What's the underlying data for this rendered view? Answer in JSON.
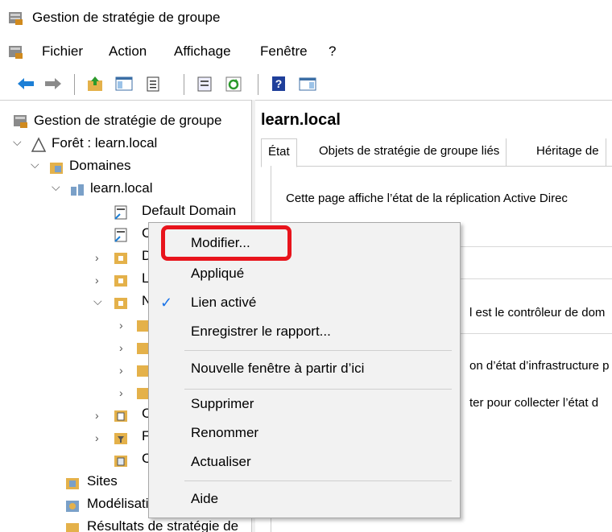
{
  "window": {
    "title": "Gestion de stratégie de groupe"
  },
  "menubar": {
    "items": [
      "Fichier",
      "Action",
      "Affichage",
      "Fenêtre",
      "?"
    ]
  },
  "toolbar": {
    "buttons": [
      "back-arrow-icon",
      "forward-arrow-icon",
      "up-folder-icon",
      "show-hide-tree-icon",
      "properties-icon",
      "export-list-icon",
      "refresh-icon",
      "help-icon",
      "console-tree-icon"
    ]
  },
  "tree": {
    "root": "Gestion de stratégie de groupe",
    "forest": "Forêt : learn.local",
    "domains": "Domaines",
    "domain": "learn.local",
    "gpo_default": "Default Domain",
    "gpo_selected": "C",
    "items_partial": [
      "D",
      "L",
      "N",
      "",
      "",
      "",
      "",
      "C",
      "F",
      "C"
    ],
    "sites": "Sites",
    "modeling": "Modélisation de stratég",
    "results": "Résultats de stratégie de"
  },
  "right": {
    "heading": "learn.local",
    "tabs": [
      "État",
      "Objets de stratégie de groupe liés",
      "Héritage de"
    ],
    "lines": [
      "Cette page affiche l’état de la réplication Active Direc",
      "l est le contrôleur de dom",
      "on d’état d’infrastructure p",
      "ter pour collecter l’état d"
    ]
  },
  "context_menu": {
    "items": [
      {
        "label": "Modifier...",
        "checked": false
      },
      {
        "label": "Appliqué",
        "checked": false
      },
      {
        "label": "Lien activé",
        "checked": true
      },
      {
        "label": "Enregistrer le rapport...",
        "checked": false
      },
      {
        "label": "Nouvelle fenêtre à partir d’ici",
        "checked": false
      },
      {
        "label": "Supprimer",
        "checked": false
      },
      {
        "label": "Renommer",
        "checked": false
      },
      {
        "label": "Actualiser",
        "checked": false
      },
      {
        "label": "Aide",
        "checked": false
      }
    ],
    "check_mark": "✓"
  },
  "colors": {
    "highlight": "#e8141c",
    "accent": "#1a73e8"
  }
}
